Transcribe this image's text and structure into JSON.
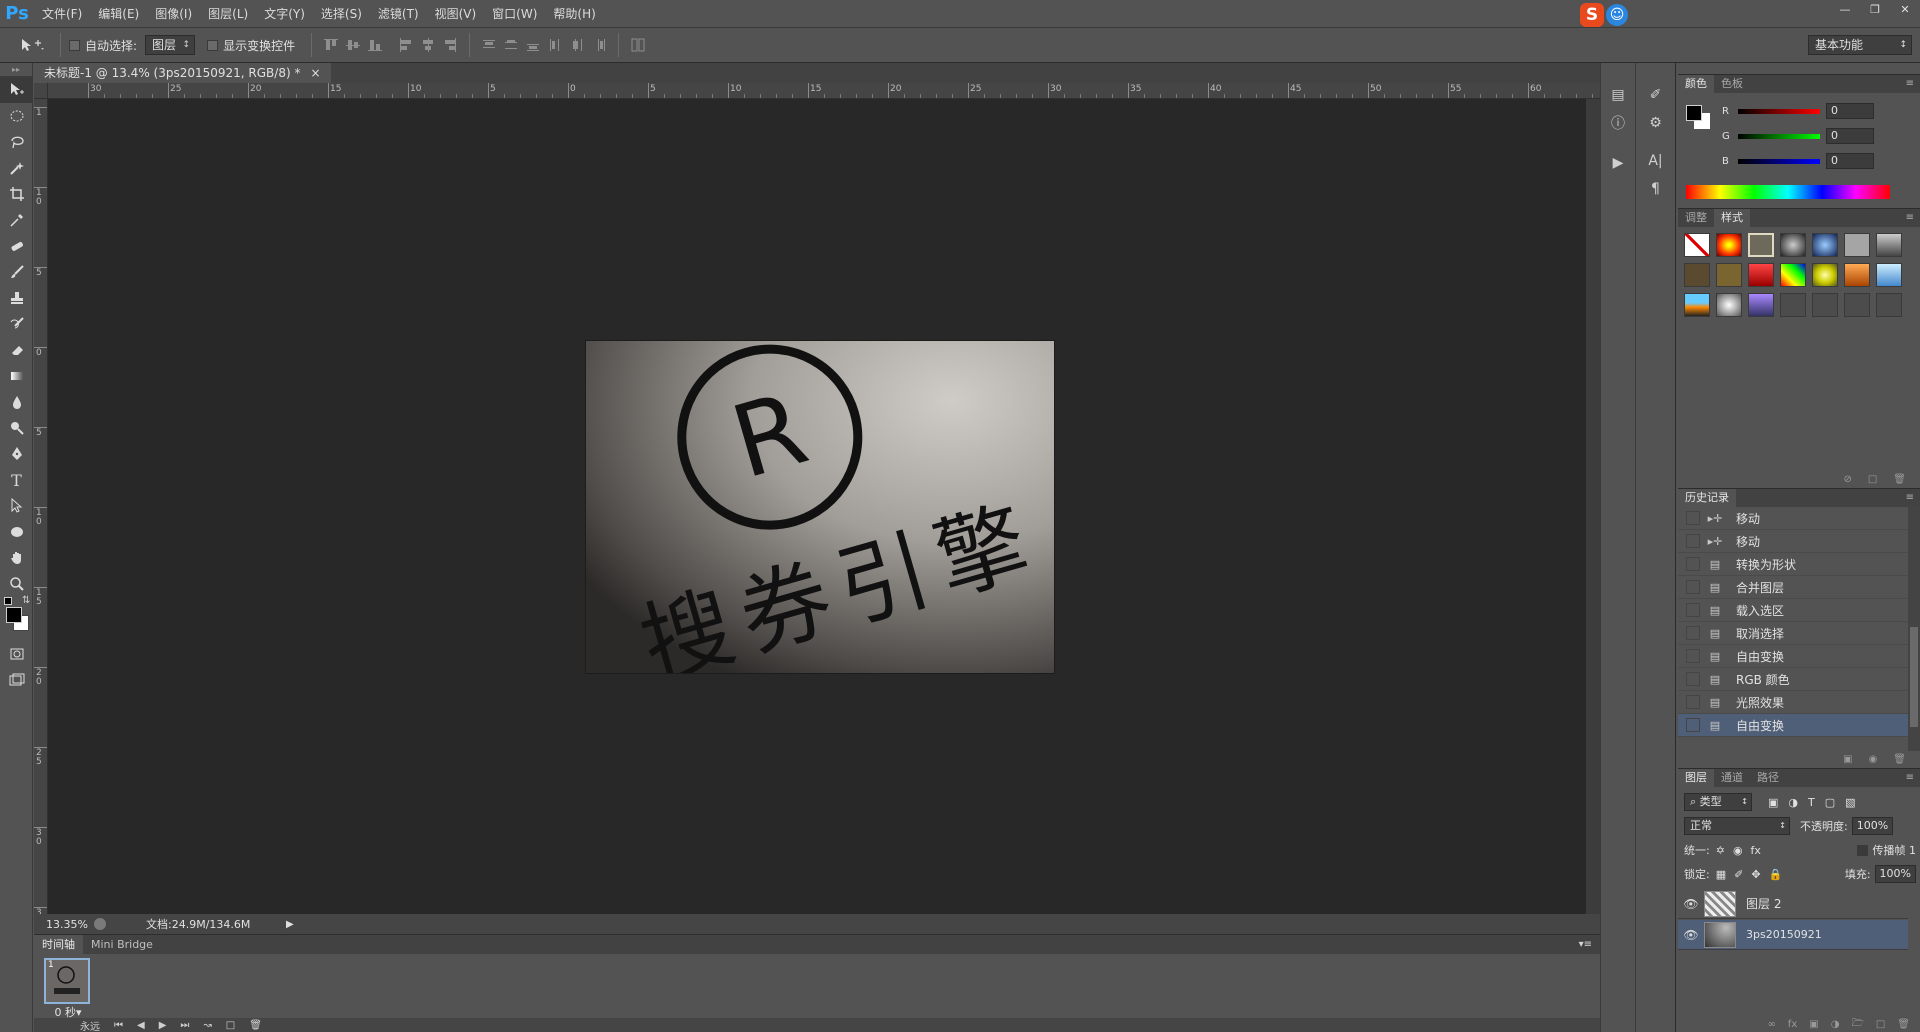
{
  "app": {
    "logo": "Ps"
  },
  "menu": [
    "文件(F)",
    "编辑(E)",
    "图像(I)",
    "图层(L)",
    "文字(Y)",
    "选择(S)",
    "滤镜(T)",
    "视图(V)",
    "窗口(W)",
    "帮助(H)"
  ],
  "window_controls": {
    "minimize": "—",
    "restore": "❐",
    "close": "✕"
  },
  "ime": {
    "letter": "S",
    "face": "☺"
  },
  "options": {
    "auto_select_label": "自动选择:",
    "auto_select_value": "图层",
    "show_transform_label": "显示变换控件",
    "workspace": "基本功能"
  },
  "document": {
    "tab_title": "未标题-1 @ 13.4% (3ps20150921, RGB/8) *",
    "tab_close": "×",
    "zoom": "13.35%",
    "doc_info": "文档:24.9M/134.6M",
    "image_text": "搜券引擎",
    "image_mark": "R"
  },
  "rulers": {
    "h": [
      "30",
      "25",
      "20",
      "15",
      "10",
      "5",
      "0",
      "5",
      "10",
      "15",
      "20",
      "25",
      "30",
      "35",
      "40",
      "45",
      "50",
      "55",
      "60"
    ],
    "v": [
      "1",
      "1 0",
      "5",
      "0",
      "5",
      "1 0",
      "1 5",
      "2 0",
      "2 5",
      "3 0",
      "3 5"
    ]
  },
  "timeline": {
    "tabs": [
      "时间轴",
      "Mini Bridge"
    ],
    "frame_number": "1",
    "frame_time": "0 秒▾",
    "loop": "永远"
  },
  "panels": {
    "color": {
      "tabs": [
        "颜色",
        "色板"
      ],
      "r": "0",
      "g": "0",
      "b": "0",
      "r_label": "R",
      "g_label": "G",
      "b_label": "B"
    },
    "styles": {
      "tabs": [
        "调整",
        "样式"
      ]
    },
    "history": {
      "tab": "历史记录",
      "items": [
        {
          "label": "移动",
          "icon": "▸✛"
        },
        {
          "label": "移动",
          "icon": "▸✛"
        },
        {
          "label": "转换为形状",
          "icon": "▤"
        },
        {
          "label": "合并图层",
          "icon": "▤"
        },
        {
          "label": "载入选区",
          "icon": "▤"
        },
        {
          "label": "取消选择",
          "icon": "▤"
        },
        {
          "label": "自由变换",
          "icon": "▤"
        },
        {
          "label": "RGB 颜色",
          "icon": "▤"
        },
        {
          "label": "光照效果",
          "icon": "▤"
        },
        {
          "label": "自由变换",
          "icon": "▤"
        }
      ]
    },
    "layers": {
      "tabs": [
        "图层",
        "通道",
        "路径"
      ],
      "filter": "⌕ 类型",
      "blend_mode": "正常",
      "opacity_label": "不透明度:",
      "opacity": "100%",
      "unify_label": "统一:",
      "propagate_label": "传播帧 1",
      "lock_label": "锁定:",
      "fill_label": "填充:",
      "fill": "100%",
      "items": [
        {
          "name": "图层 2"
        },
        {
          "name": "3ps20150921"
        }
      ]
    }
  }
}
